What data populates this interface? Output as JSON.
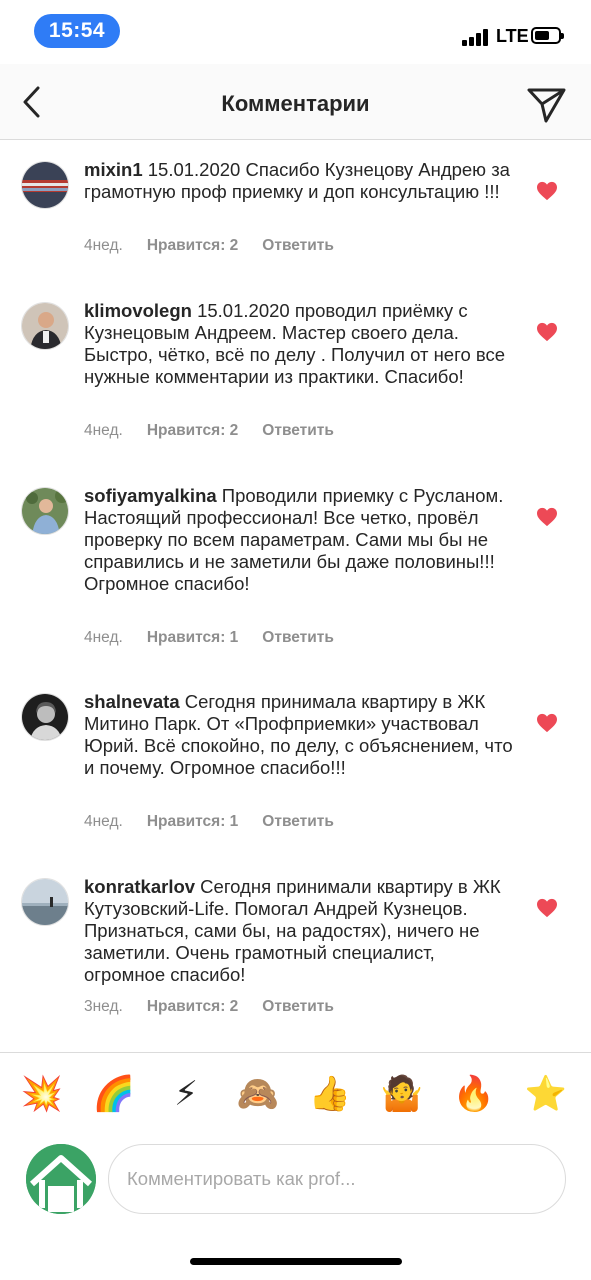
{
  "status": {
    "time": "15:54",
    "network": "LTE"
  },
  "nav": {
    "title": "Комментарии"
  },
  "comments": [
    {
      "user": "mixin1",
      "text": " 15.01.2020 Спасибо Кузнецову Андрею за грамотную проф приемку и доп консультацию !!!",
      "age": "4нед.",
      "likes": "Нравится: 2",
      "reply": "Ответить"
    },
    {
      "user": "klimovolegn",
      "text": " 15.01.2020 проводил приёмку с Кузнецовым Андреем. Мастер своего дела. Быстро, чётко, всё по делу . Получил от него все нужные комментарии из практики. Спасибо!",
      "age": "4нед.",
      "likes": "Нравится: 2",
      "reply": "Ответить"
    },
    {
      "user": "sofiyamyalkina",
      "text": " Проводили приемку с Русланом. Настоящий профессионал! Все четко, провёл проверку по всем параметрам. Сами мы бы не справились и не заметили бы даже половины!!! Огромное спасибо!",
      "age": "4нед.",
      "likes": "Нравится: 1",
      "reply": "Ответить"
    },
    {
      "user": "shalnevata",
      "text": " Сегодня принимала квартиру в ЖК Митино Парк. От «Профприемки» участвовал Юрий. Всё спокойно, по делу, с объяснением, что и почему. Огромное спасибо!!!",
      "age": "4нед.",
      "likes": "Нравится: 1",
      "reply": "Ответить"
    },
    {
      "user": "konratkarlov",
      "text": " Сегодня принимали квартиру в ЖК Кутузовский-Life. Помогал Андрей Кузнецов. Признаться, сами бы, на радостях), ничего не заметили. Очень грамотный специалист, огромное спасибо!",
      "age": "3нед.",
      "likes": "Нравится: 2",
      "reply": "Ответить"
    }
  ],
  "emojis": [
    "💥",
    "🌈",
    "⚡",
    "🙈",
    "👍",
    "🤷",
    "🔥",
    "⭐"
  ],
  "input": {
    "placeholder": "Комментировать как prof..."
  },
  "colors": {
    "heart": "#ed4956",
    "accent": "#2f7cf6",
    "profile": "#3ba365"
  }
}
